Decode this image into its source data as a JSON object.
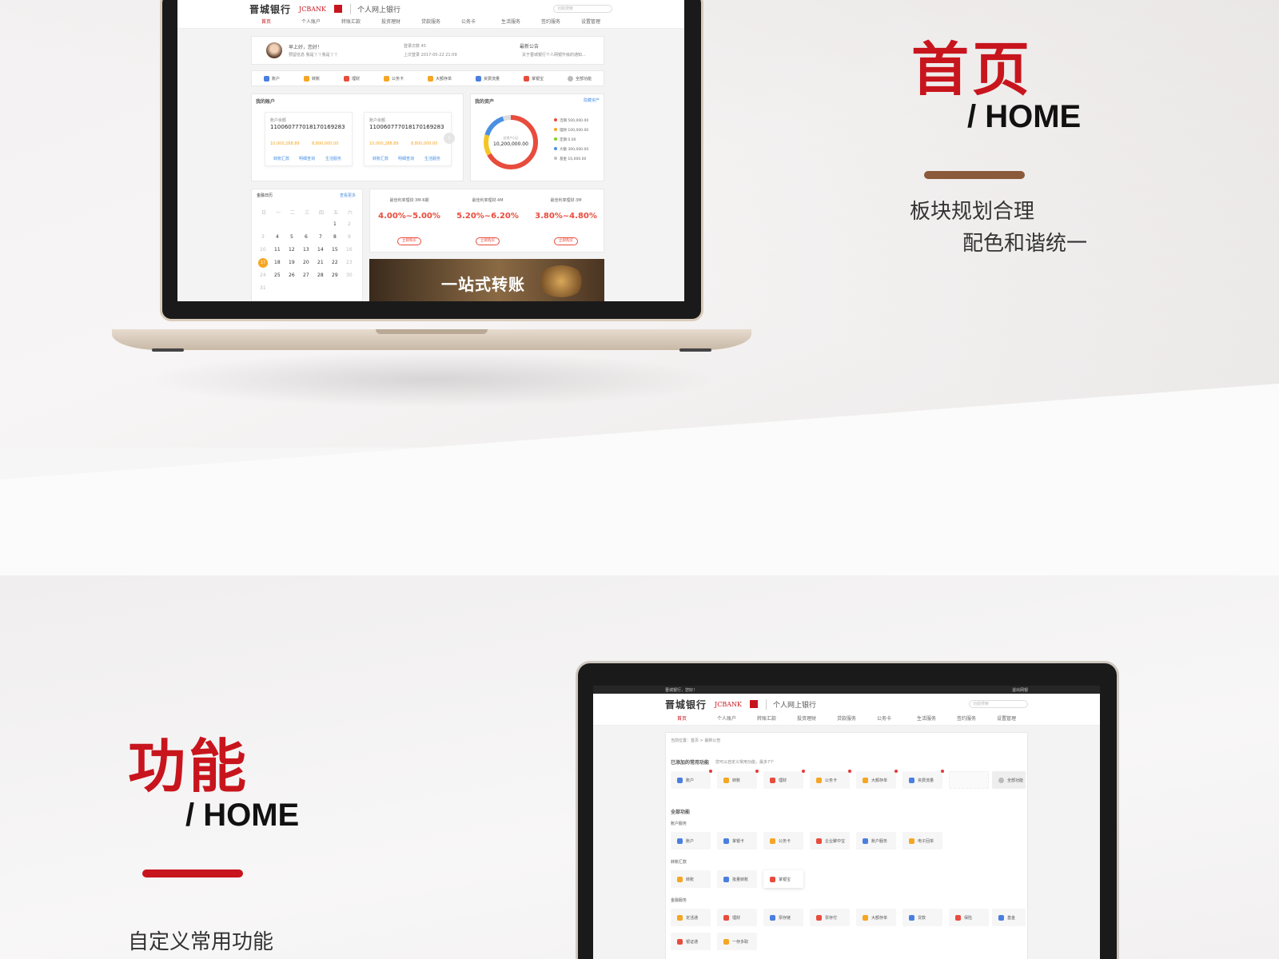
{
  "section1": {
    "title": "首页",
    "subtitle": "/ HOME",
    "desc_line1": "板块规划合理",
    "desc_line2": "配色和谐统一",
    "bar_color": "#8a5a3a"
  },
  "section2": {
    "title": "功能",
    "subtitle": "/ HOME",
    "desc_line1": "自定义常用功能",
    "bar_color": "#c8151d"
  },
  "bank": {
    "name_cn": "晋城银行",
    "name_en": "JCBANK",
    "portal": "个人网上银行",
    "search_placeholder": "功能搜索",
    "nav": [
      "首页",
      "个人账户",
      "转账汇款",
      "投资理财",
      "贷款服务",
      "公务卡",
      "生活服务",
      "签约服务",
      "设置管理"
    ],
    "topstrip_left": "晋城银行，您好！",
    "topstrip_right": "退出网银"
  },
  "home": {
    "greeting": "早上好，您好！",
    "greeting_sub": "预留信息 我是丫丫我是丫丫",
    "login_count": "登录次数 45",
    "last_login": "上次登录 2017-05-22 21:09",
    "notice_title": "最新公告",
    "notice_text": "关于晋城银行个人网银升级的通知...",
    "quick": [
      "账户",
      "转账",
      "理财",
      "公务卡",
      "大额存单",
      "资费流量",
      "掌银宝",
      "全部功能"
    ],
    "my_accounts_title": "我的账户",
    "accounts": [
      {
        "number": "110060777018170169283",
        "label": "账户余额",
        "avail": "10,000,288.89",
        "avail2": "8,800,000.00",
        "links": [
          "转账汇款",
          "明细查询",
          "生活服务"
        ]
      },
      {
        "number": "110060777018170169283",
        "label": "账户余额",
        "avail": "10,000,288.89",
        "avail2": "8,800,000.00",
        "links": [
          "转账汇款",
          "明细查询",
          "生活服务"
        ]
      }
    ],
    "assets_title": "我的资产",
    "assets_link": "隐藏资产",
    "assets_total_label": "总资产(元)",
    "assets_total": "10,200,000.00",
    "assets_legend": [
      {
        "name": "活期 500,000.00",
        "color": "#e84c3d"
      },
      {
        "name": "理财 100,000.00",
        "color": "#f5a623"
      },
      {
        "name": "定期 0.00",
        "color": "#7ed321"
      },
      {
        "name": "大额 300,000.00",
        "color": "#4a90e2"
      },
      {
        "name": "基金 10,000.00",
        "color": "#c0c0c0"
      }
    ],
    "calendar_title": "金融日历",
    "calendar_link": "查看更多",
    "weekdays": [
      "日",
      "一",
      "二",
      "三",
      "四",
      "五",
      "六"
    ],
    "products": [
      {
        "title": "最佳利率理财·3M-6期",
        "rate": "4.00%~5.00%",
        "btn": "立即购买"
      },
      {
        "title": "最佳利率理财·4M",
        "rate": "5.20%~6.20%",
        "btn": "立即购买"
      },
      {
        "title": "最佳利率理财·3M",
        "rate": "3.80%~4.80%",
        "btn": "立即购买"
      }
    ],
    "banner_text": "一站式转账"
  },
  "func": {
    "breadcrumb": "当前位置：首页 > 最新公告",
    "added_title": "已添加的常用功能",
    "added_hint": "您可以自定义常用功能，最多7个",
    "added": [
      "账户",
      "转账",
      "理财",
      "公务卡",
      "大额存单",
      "资费流量"
    ],
    "all_btn": "全部功能",
    "all_title": "全部功能",
    "groups": [
      {
        "name": "账户服务",
        "items": [
          "账户",
          "掌银卡",
          "公务卡",
          "企业聚中宝",
          "账户服务",
          "电子回单"
        ]
      },
      {
        "name": "转账汇款",
        "items": [
          "转账",
          "批量转账",
          "掌银宝"
        ]
      },
      {
        "name": "金融服务",
        "items": [
          "定活通",
          "理财",
          "票存链",
          "票存付",
          "大额存单",
          "贷款",
          "保险",
          "基金"
        ]
      }
    ],
    "more": [
      "银证通",
      "一存多取"
    ]
  }
}
